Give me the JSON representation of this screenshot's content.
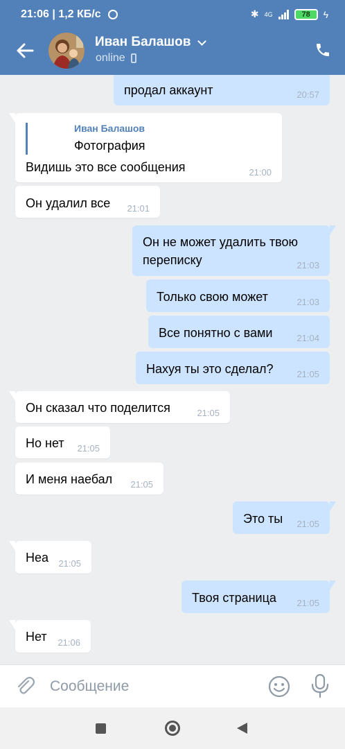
{
  "status_bar": {
    "time_speed": "21:06 | 1,2 КБ/с",
    "network": "4G",
    "battery": "78"
  },
  "header": {
    "name": "Иван Балашов",
    "status": "online"
  },
  "messages": [
    {
      "text": "продал аккаунт",
      "time": "20:57"
    },
    {
      "forward_name": "Иван Балашов",
      "forward_text": "Фотография",
      "text": "Видишь это все сообщения",
      "time": "21:00"
    },
    {
      "text": "Он удалил все",
      "time": "21:01"
    },
    {
      "text": "Он не может удалить твою",
      "text2": "переписку",
      "time": "21:03"
    },
    {
      "text": "Только свою может",
      "time": "21:03"
    },
    {
      "text": "Все понятно с вами",
      "time": "21:04"
    },
    {
      "text": "Нахуя ты это сделал?",
      "time": "21:05"
    },
    {
      "text": "Он сказал что поделится",
      "time": "21:05"
    },
    {
      "text": "Но нет",
      "time": "21:05"
    },
    {
      "text": "И меня наебал",
      "time": "21:05"
    },
    {
      "text": "Это ты",
      "time": "21:05"
    },
    {
      "text": "Неа",
      "time": "21:05"
    },
    {
      "text": "Твоя страница",
      "time": "21:05"
    },
    {
      "text": "Нет",
      "time": "21:06"
    }
  ],
  "composer": {
    "placeholder": "Сообщение"
  },
  "colors": {
    "header": "#5181b8",
    "outgoing_bubble": "#cce4ff",
    "incoming_bubble": "#ffffff",
    "background": "#edeef0"
  },
  "icons": [
    "back-arrow-icon",
    "call-icon",
    "attach-icon",
    "emoji-icon",
    "mic-icon"
  ]
}
